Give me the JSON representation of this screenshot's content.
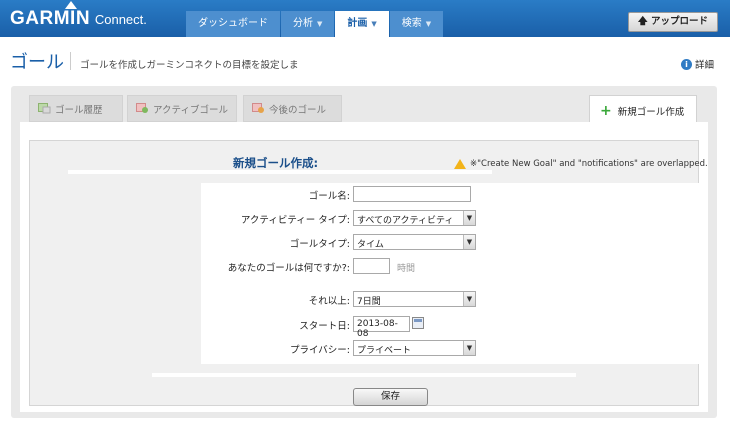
{
  "header": {
    "brand": "GARMIN",
    "product": "Connect.",
    "nav": [
      {
        "label": "ダッシュボード",
        "has_caret": false,
        "active": false
      },
      {
        "label": "分析",
        "has_caret": true,
        "active": false
      },
      {
        "label": "計画",
        "has_caret": true,
        "active": true
      },
      {
        "label": "検索",
        "has_caret": true,
        "active": false
      }
    ],
    "upgrade_label": "アップロード"
  },
  "page": {
    "title": "ゴール",
    "description": "ゴールを作成しガーミンコネクトの目標を設定しま",
    "detail_label": "詳細"
  },
  "tabs": [
    {
      "label": "ゴール履歴",
      "icon": "goal-history-icon"
    },
    {
      "label": "アクティブゴール",
      "icon": "active-goal-icon"
    },
    {
      "label": "今後のゴール",
      "icon": "upcoming-goal-icon"
    },
    {
      "label": "新規ゴール作成",
      "icon": "plus-icon"
    }
  ],
  "form": {
    "title": "新規ゴール作成:",
    "warning": "※\"Create New Goal\" and \"notifications\" are overlapped.",
    "fields": {
      "goal_name": {
        "label": "ゴール名:",
        "value": ""
      },
      "activity_type": {
        "label": "アクティビティー タイプ:",
        "value": "すべてのアクティビティ"
      },
      "goal_type": {
        "label": "ゴールタイプ:",
        "value": "タイム"
      },
      "goal_amount": {
        "label": "あなたのゴールは何ですか?:",
        "value": "",
        "unit": "時間"
      },
      "over": {
        "label": "それ以上:",
        "value": "7日間"
      },
      "start_date": {
        "label": "スタート日:",
        "value": "2013-08-08"
      },
      "privacy": {
        "label": "プライバシー:",
        "value": "プライベート"
      }
    },
    "save_label": "保存"
  },
  "colors": {
    "header_blue": "#1f69b4",
    "title_blue": "#1b4f8a",
    "add_green": "#3aa83a",
    "warning_yellow": "#f2b31a"
  }
}
